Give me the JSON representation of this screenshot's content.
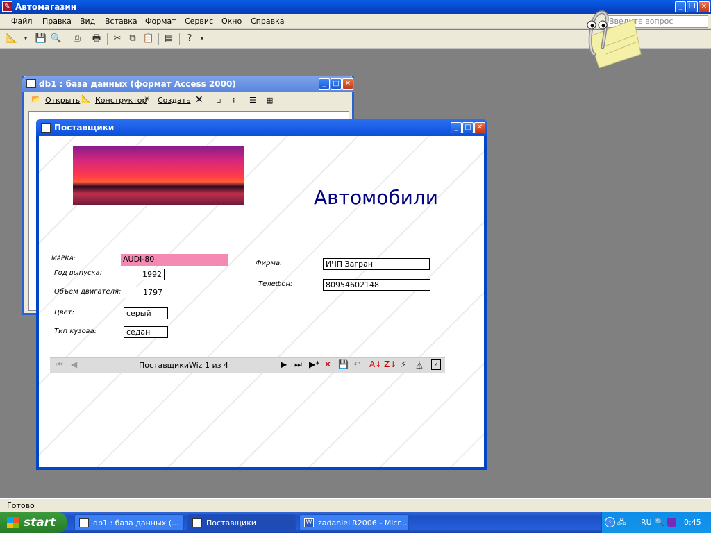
{
  "app": {
    "title": "Автомагазин"
  },
  "menu": [
    "Файл",
    "Правка",
    "Вид",
    "Вставка",
    "Формат",
    "Сервис",
    "Окно",
    "Справка"
  ],
  "help_box": {
    "placeholder": "Введите вопрос"
  },
  "db_window": {
    "title": "db1 : база данных (формат Access 2000)",
    "tools": {
      "open": "Открыть",
      "design": "Конструктор",
      "create": "Создать"
    }
  },
  "form_window": {
    "title": "Поставщики",
    "heading": "Автомобили",
    "fields": {
      "marka_label": "МАРКА:",
      "marka_value": "AUDI-80",
      "year_label": "Год выпуска:",
      "year_value": "1992",
      "engine_label": "Объем двигателя:",
      "engine_value": "1797",
      "color_label": "Цвет:",
      "color_value": "серый",
      "body_label": "Тип кузова:",
      "body_value": "седан",
      "firm_label": "Фирма:",
      "firm_value": "ИЧП Загран",
      "phone_label": "Телефон:",
      "phone_value": "80954602148"
    },
    "nav": {
      "record_text": "ПоставщикиWiz 1 из 4"
    }
  },
  "statusbar": {
    "text": "Готово"
  },
  "taskbar": {
    "start": "start",
    "tasks": [
      "db1 : база данных (...",
      "Поставщики",
      "zadanieLR2006 - Micr..."
    ],
    "lang": "RU",
    "clock": "0:45"
  },
  "colors": {
    "accent": "#0a4fd8",
    "marka_highlight": "#f48ab4",
    "heading": "#000080"
  }
}
